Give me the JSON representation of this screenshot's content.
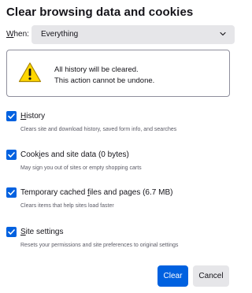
{
  "dialog": {
    "title": "Clear browsing data and cookies",
    "when": {
      "label_first": "W",
      "label_rest": "hen:",
      "selected": "Everything",
      "chevron_icon": "chevron-down-icon"
    },
    "warning": {
      "icon": "warning-triangle-icon",
      "line1": "All history will be cleared.",
      "line2": "This action cannot be undone."
    },
    "options": [
      {
        "label_pre": "",
        "label_key": "H",
        "label_post": "istory",
        "description": "Clears site and download history, saved form info, and searches",
        "checked": true
      },
      {
        "label_pre": "Cook",
        "label_key": "i",
        "label_post": "es and site data (0 bytes)",
        "description": "May sign you out of sites or empty shopping carts",
        "checked": true
      },
      {
        "label_pre": "Temporary cached ",
        "label_key": "f",
        "label_post": "iles and pages (6.7 MB)",
        "description": "Clears items that help sites load faster",
        "checked": true
      },
      {
        "label_pre": "",
        "label_key": "S",
        "label_post": "ite settings",
        "description": "Resets your permissions and site preferences to original settings",
        "checked": true
      }
    ],
    "buttons": {
      "clear": "Clear",
      "cancel": "Cancel"
    },
    "colors": {
      "accent": "#0061e0",
      "warning_yellow": "#ffd700",
      "select_bg": "#e6e6e9"
    }
  }
}
